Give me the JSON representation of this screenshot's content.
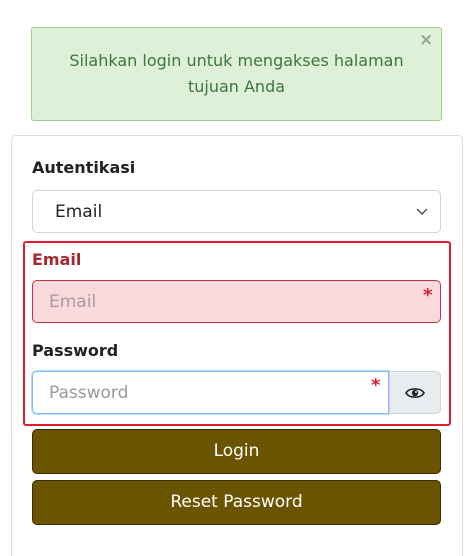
{
  "alert": {
    "message": "Silahkan login untuk mengakses halaman tujuan Anda",
    "close_symbol": "×"
  },
  "form": {
    "auth_label": "Autentikasi",
    "auth_selected": "Email",
    "email_label": "Email",
    "email_placeholder": "Email",
    "password_label": "Password",
    "password_placeholder": "Password",
    "required_marker": "*",
    "login_button": "Login",
    "reset_button": "Reset Password"
  },
  "icons": {
    "chevron": "chevron-down-icon",
    "eye": "eye-icon"
  },
  "colors": {
    "alert_bg": "#dff0d8",
    "alert_text": "#3c763d",
    "error_red": "#e11d2e",
    "button_brown": "#6b5400"
  }
}
